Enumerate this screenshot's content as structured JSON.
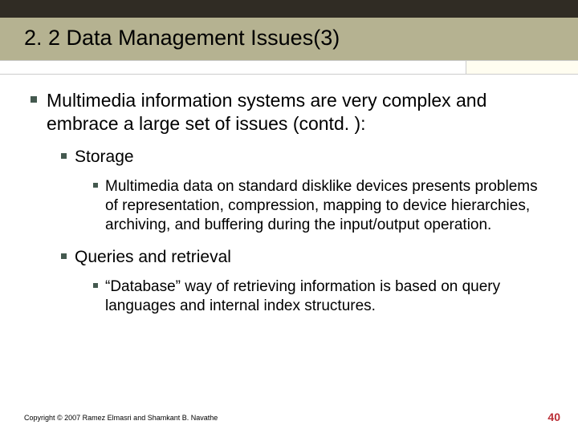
{
  "slide": {
    "title": "2. 2 Data Management Issues(3)",
    "main_point": "Multimedia information systems are very complex and embrace a large set of issues (contd. ):",
    "subpoints": [
      {
        "heading": "Storage",
        "detail": "Multimedia data on standard disklike devices presents problems of representation, compression, mapping to device hierarchies, archiving, and buffering during the input/output operation."
      },
      {
        "heading": "Queries and retrieval",
        "detail": "“Database” way of retrieving information is based on query languages and internal index structures."
      }
    ],
    "copyright": "Copyright © 2007 Ramez Elmasri and Shamkant B. Navathe",
    "page_number": "40"
  }
}
